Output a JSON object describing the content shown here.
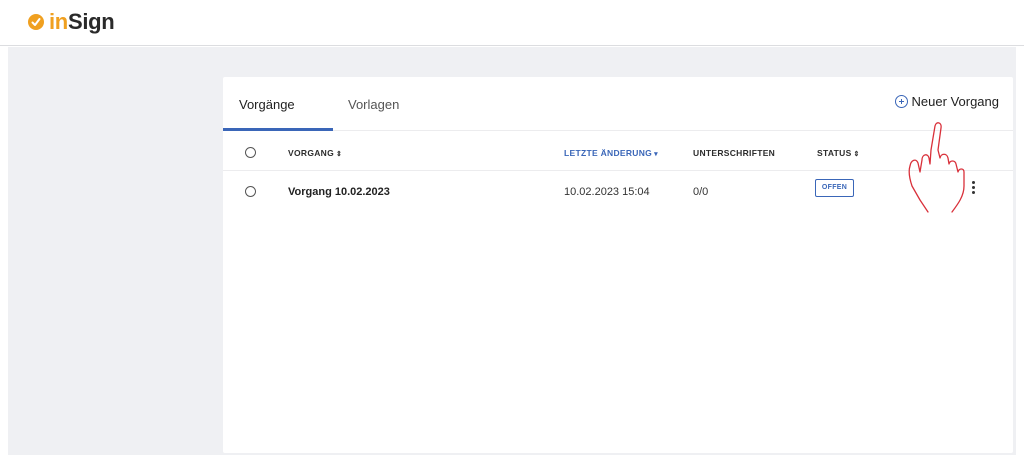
{
  "app": {
    "logo_prefix": "in",
    "logo_suffix": "Sign"
  },
  "tabs": [
    {
      "label": "Vorgänge",
      "active": true
    },
    {
      "label": "Vorlagen",
      "active": false
    }
  ],
  "actions": {
    "new_label": "Neuer Vorgang"
  },
  "table": {
    "columns": [
      {
        "label": "VORGANG",
        "sort": "⇕",
        "sorted": false
      },
      {
        "label": "LETZTE ÄNDERUNG",
        "sort": "▾",
        "sorted": true
      },
      {
        "label": "UNTERSCHRIFTEN",
        "sort": "",
        "sorted": false
      },
      {
        "label": "STATUS",
        "sort": "⇕",
        "sorted": false
      }
    ],
    "rows": [
      {
        "name": "Vorgang 10.02.2023",
        "changed": "10.02.2023 15:04",
        "signatures": "0/0",
        "status": "OFFEN"
      }
    ]
  },
  "colors": {
    "accent": "#3a66b8",
    "brand": "#f0a020",
    "background": "#eff0f3",
    "annotation": "#d9303a"
  },
  "icons": {
    "add": "plus-circle-icon",
    "row_menu": "more-vertical-icon",
    "annotation": "pointing-hand-icon"
  }
}
